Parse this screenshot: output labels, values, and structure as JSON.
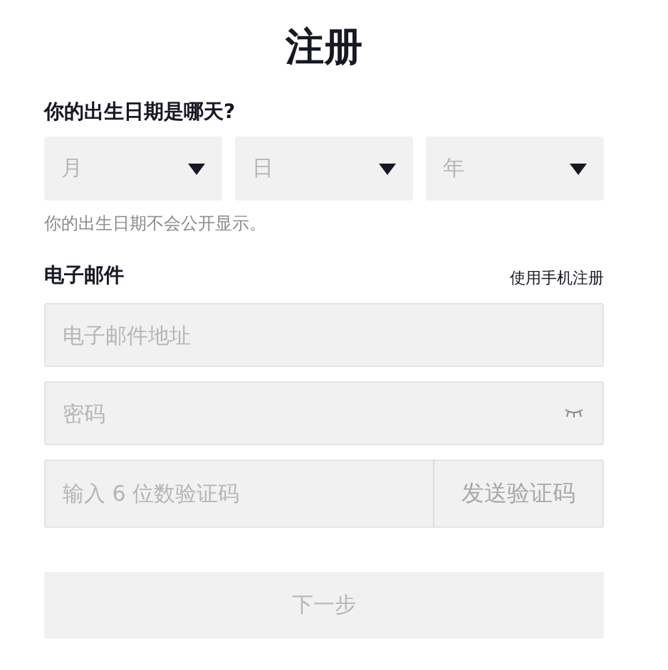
{
  "title": "注册",
  "birthday": {
    "label": "你的出生日期是哪天?",
    "selects": [
      {
        "placeholder": "月"
      },
      {
        "placeholder": "日"
      },
      {
        "placeholder": "年"
      }
    ],
    "hint": "你的出生日期不会公开显示。"
  },
  "email": {
    "label": "电子邮件",
    "switch_link": "使用手机注册",
    "address": {
      "placeholder": "电子邮件地址"
    },
    "password": {
      "placeholder": "密码",
      "visible": false
    },
    "code": {
      "placeholder": "输入 6 位数验证码"
    },
    "send_button": "发送验证码"
  },
  "next_button": {
    "label": "下一步",
    "disabled": true
  }
}
